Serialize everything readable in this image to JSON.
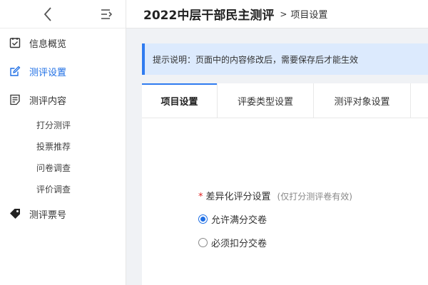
{
  "header": {
    "title": "2022中层干部民主测评",
    "separator": ">",
    "breadcrumb": "项目设置"
  },
  "sidebar": {
    "items": [
      {
        "label": "信息概览",
        "icon": "checklist-icon",
        "active": false
      },
      {
        "label": "测评设置",
        "icon": "edit-icon",
        "active": true
      },
      {
        "label": "测评内容",
        "icon": "document-list-icon",
        "active": false
      }
    ],
    "subitems": [
      {
        "label": "打分测评"
      },
      {
        "label": "投票推荐"
      },
      {
        "label": "问卷调查"
      },
      {
        "label": "评价调查"
      }
    ],
    "last_item": {
      "label": "测评票号",
      "icon": "tag-icon"
    }
  },
  "notice": {
    "text": "提示说明：页面中的内容修改后，需要保存后才能生效"
  },
  "tabs": [
    {
      "label": "项目设置",
      "active": true
    },
    {
      "label": "评委类型设置",
      "active": false
    },
    {
      "label": "测评对象设置",
      "active": false
    }
  ],
  "form": {
    "required_mark": "*",
    "label": "差异化评分设置",
    "hint": "(仅打分测评卷有效)",
    "options": [
      {
        "label": "允许满分交卷",
        "checked": true
      },
      {
        "label": "必须扣分交卷",
        "checked": false
      }
    ]
  },
  "colors": {
    "accent": "#1f6fe5",
    "notice_bg": "#dceafd",
    "notice_border": "#2f7bf0",
    "required": "#e02020"
  }
}
